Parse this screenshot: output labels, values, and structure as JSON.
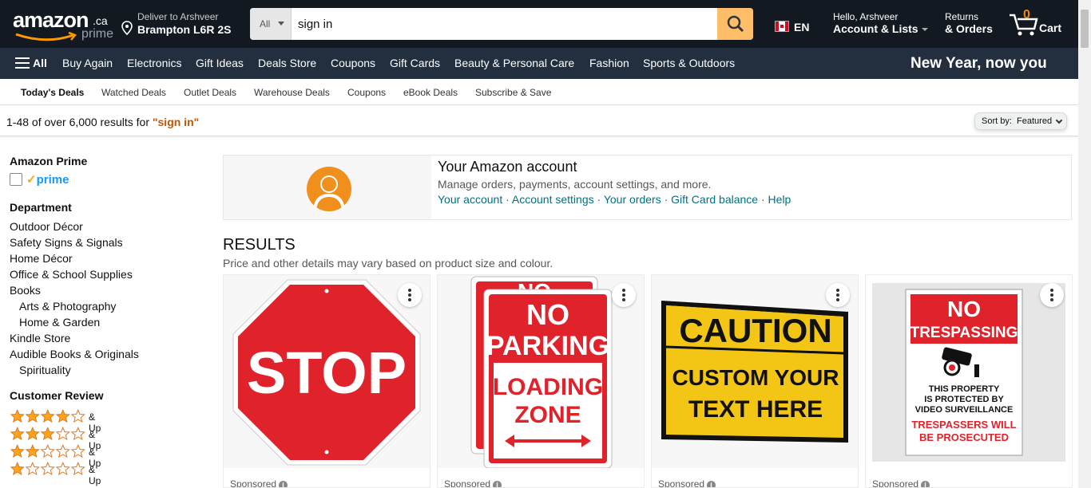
{
  "header": {
    "logo_text": "amazon",
    "logo_domain": ".ca",
    "logo_prime": "prime",
    "deliver_line1": "Deliver to Arshveer",
    "deliver_line2": "Brampton L6R 2S",
    "search_category": "All",
    "search_value": "sign in",
    "language": "EN",
    "account_line1": "Hello, Arshveer",
    "account_line2": "Account & Lists",
    "returns_line1": "Returns",
    "returns_line2": "& Orders",
    "cart_count": "0",
    "cart_label": "Cart"
  },
  "main_nav": {
    "all_label": "All",
    "items": [
      "Buy Again",
      "Electronics",
      "Gift Ideas",
      "Deals Store",
      "Coupons",
      "Gift Cards",
      "Beauty & Personal Care",
      "Fashion",
      "Sports & Outdoors"
    ],
    "promo": "New Year, now you"
  },
  "sub_nav": {
    "items": [
      "Today's Deals",
      "Watched Deals",
      "Outlet Deals",
      "Warehouse Deals",
      "Coupons",
      "eBook Deals",
      "Subscribe & Save"
    ]
  },
  "results_bar": {
    "count_text": "1-48 of over 6,000 results for ",
    "query": "\"sign in\"",
    "sort_label": "Sort by:",
    "sort_value": "Featured"
  },
  "sidebar": {
    "prime_heading": "Amazon Prime",
    "prime_label": "prime",
    "department_heading": "Department",
    "departments": [
      "Outdoor Décor",
      "Safety Signs & Signals",
      "Home Décor",
      "Office & School Supplies",
      "Books",
      "Arts & Photography",
      "Home & Garden",
      "Kindle Store",
      "Audible Books & Originals",
      "Spirituality"
    ],
    "review_heading": "Customer Review",
    "review_up_label": "& Up",
    "ratings": [
      4,
      3,
      2,
      1
    ]
  },
  "account_card": {
    "title": "Your Amazon account",
    "description": "Manage orders, payments, account settings, and more.",
    "links": [
      "Your account",
      "Account settings",
      "Your orders",
      "Gift Card balance",
      "Help"
    ]
  },
  "results": {
    "title": "RESULTS",
    "subtitle": "Price and other details may vary based on product size and colour.",
    "sponsored_label": "Sponsored"
  },
  "products": [
    {
      "sign_text": "STOP"
    },
    {
      "sign_text_1": "NO",
      "sign_text_2": "PARKING",
      "sign_text_3": "LOADING",
      "sign_text_4": "ZONE",
      "sign_back_text": "NO"
    },
    {
      "sign_text_1": "CAUTION",
      "sign_text_2": "CUSTOM YOUR",
      "sign_text_3": "TEXT HERE"
    },
    {
      "sign_text_1": "NO",
      "sign_text_2": "TRESPASSING",
      "sign_text_3": "THIS PROPERTY",
      "sign_text_4": "IS PROTECTED BY",
      "sign_text_5": "VIDEO SURVEILLANCE",
      "sign_text_6": "TRESPASSERS WILL",
      "sign_text_7": "BE PROSECUTED"
    }
  ],
  "colors": {
    "nav_dark": "#131921",
    "nav_secondary": "#232f3e",
    "search_button": "#febd69",
    "link": "#007185",
    "query_highlight": "#c45500",
    "star": "#ffa41c"
  }
}
